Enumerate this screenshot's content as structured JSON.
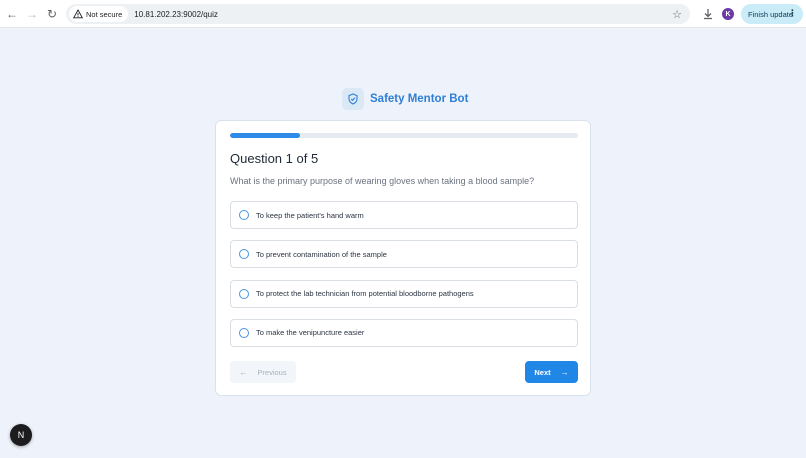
{
  "browser": {
    "back_glyph": "←",
    "forward_glyph": "→",
    "reload_glyph": "↻",
    "security_label": "Not secure",
    "url": "10.81.202.23:9002/quiz",
    "star_glyph": "☆",
    "profile_initial": "K",
    "update_label": "Finish update",
    "menu_glyph": "⋮"
  },
  "app": {
    "title": "Safety Mentor Bot",
    "icon": "shield-icon",
    "accent_color": "#2f7fd6"
  },
  "quiz": {
    "progress": 0.2,
    "heading": "Question 1 of 5",
    "question": "What is the primary purpose of wearing gloves when taking a blood sample?",
    "options": [
      "To keep the patient's hand warm",
      "To prevent contamination of the sample",
      "To protect the lab technician from potential bloodborne pathogens",
      "To make the venipuncture easier"
    ],
    "previous_label": "Previous",
    "next_label": "Next",
    "arrow_left": "←",
    "arrow_right": "→"
  },
  "dev_badge": {
    "letter": "N"
  }
}
